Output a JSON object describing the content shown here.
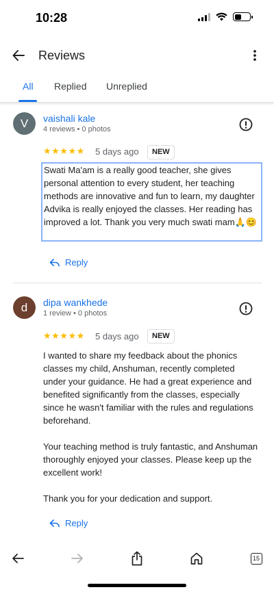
{
  "status_bar": {
    "time": "10:28"
  },
  "app_bar": {
    "title": "Reviews"
  },
  "tabs": [
    {
      "label": "All",
      "active": true
    },
    {
      "label": "Replied",
      "active": false
    },
    {
      "label": "Unreplied",
      "active": false
    }
  ],
  "reviews": [
    {
      "avatar_letter": "V",
      "avatar_color": "#5f6f73",
      "name": "vaishali kale",
      "meta": "4 reviews • 0 photos",
      "stars": "★★★★★",
      "rating": 5,
      "date": "5 days ago",
      "badge": "NEW",
      "text": "Swati Ma'am is a really good teacher, she gives personal attention to every student, her teaching methods are innovative and fun to learn, my daughter Advika is really enjoyed the classes. Her reading has improved a lot. Thank you very much swati mam🙏😊",
      "reply_label": "Reply"
    },
    {
      "avatar_letter": "d",
      "avatar_color": "#6d3f2e",
      "name": "dipa wankhede",
      "meta": "1 review • 0 photos",
      "stars": "★★★★★",
      "rating": 5,
      "date": "5 days ago",
      "badge": "NEW",
      "text": "I wanted to share my feedback about the phonics classes my child, Anshuman, recently completed under your guidance. He had a great experience and benefited significantly from the classes, especially since he wasn't familiar with the rules and regulations beforehand.\n\nYour teaching method is truly fantastic, and Anshuman thoroughly enjoyed your classes. Please keep up the excellent work!\n\nThank you for your dedication and support.",
      "reply_label": "Reply"
    }
  ],
  "browser_bar": {
    "tab_count": "15"
  },
  "colors": {
    "accent": "#1a73e8",
    "star": "#fbbc04"
  }
}
